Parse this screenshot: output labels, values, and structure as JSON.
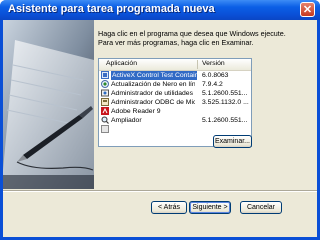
{
  "window": {
    "title": "Asistente para tarea programada nueva",
    "close_glyph": "✕"
  },
  "instructions": {
    "line1": "Haga clic en el programa que desea que Windows ejecute.",
    "line2": "Para ver más programas, haga clic en Examinar."
  },
  "list": {
    "columns": [
      "Aplicación",
      "Versión"
    ],
    "rows": [
      {
        "name": "ActiveX Control Test Container",
        "version": "6.0.8063",
        "icon": "activex-icon",
        "selected": true
      },
      {
        "name": "Actualización de Nero en línea",
        "version": "7.9.4.2",
        "icon": "nero-update-icon",
        "selected": false
      },
      {
        "name": "Administrador de utilidades",
        "version": "5.1.2600.551...",
        "icon": "utility-manager-icon",
        "selected": false
      },
      {
        "name": "Administrador ODBC de Micro...",
        "version": "3.525.1132.0 ...",
        "icon": "odbc-icon",
        "selected": false
      },
      {
        "name": "Adobe Reader 9",
        "version": "",
        "icon": "adobe-reader-icon",
        "selected": false
      },
      {
        "name": "Ampliador",
        "version": "5.1.2600.551...",
        "icon": "magnifier-icon",
        "selected": false
      },
      {
        "name": "",
        "version": "",
        "icon": "partial-row-icon",
        "selected": false
      }
    ]
  },
  "buttons": {
    "browse": "Examinar...",
    "back": "< Atrás",
    "next": "Siguiente >",
    "cancel": "Cancelar"
  },
  "colors": {
    "titlebar": "#0a4fd6",
    "selection": "#316ac5",
    "dialog_bg": "#ece9d8"
  }
}
